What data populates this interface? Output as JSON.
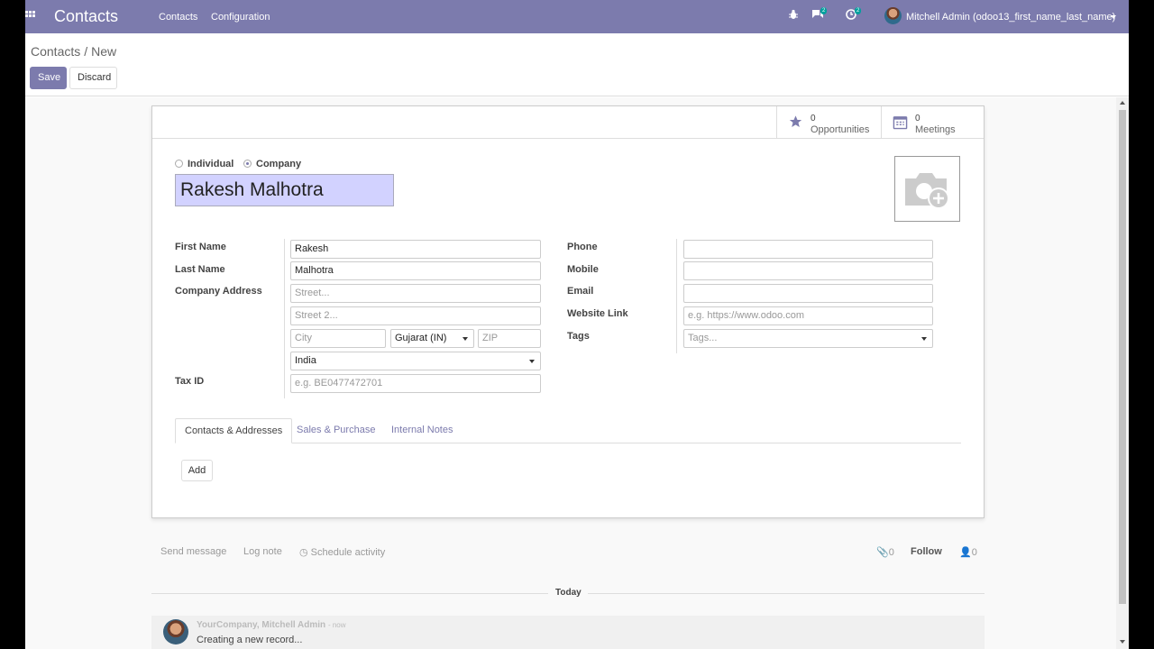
{
  "navbar": {
    "brand": "Contacts",
    "menu": [
      "Contacts",
      "Configuration"
    ],
    "messages_badge": "2",
    "activities_badge": "2",
    "user": "Mitchell Admin (odoo13_first_name_last_name)"
  },
  "breadcrumb": {
    "parent": "Contacts",
    "separator": "/",
    "current": "New"
  },
  "buttons": {
    "save": "Save",
    "discard": "Discard"
  },
  "smart_buttons": [
    {
      "count": "0",
      "label": "Opportunities",
      "icon": "star-icon"
    },
    {
      "count": "0",
      "label": "Meetings",
      "icon": "calendar-icon"
    }
  ],
  "company_type": {
    "individual": "Individual",
    "company": "Company",
    "selected": "Company"
  },
  "name": "Rakesh Malhotra",
  "left_fields": {
    "first_name": {
      "label": "First Name",
      "value": "Rakesh"
    },
    "last_name": {
      "label": "Last Name",
      "value": "Malhotra"
    },
    "address": {
      "label": "Company Address",
      "street_placeholder": "Street...",
      "street2_placeholder": "Street 2...",
      "city_placeholder": "City",
      "state": "Gujarat (IN)",
      "zip_placeholder": "ZIP",
      "country": "India"
    },
    "tax_id": {
      "label": "Tax ID",
      "placeholder": "e.g. BE0477472701"
    }
  },
  "right_fields": {
    "phone": {
      "label": "Phone",
      "value": ""
    },
    "mobile": {
      "label": "Mobile",
      "value": ""
    },
    "email": {
      "label": "Email",
      "value": ""
    },
    "website": {
      "label": "Website Link",
      "placeholder": "e.g. https://www.odoo.com"
    },
    "tags": {
      "label": "Tags",
      "placeholder": "Tags..."
    }
  },
  "tabs": [
    "Contacts & Addresses",
    "Sales & Purchase",
    "Internal Notes"
  ],
  "active_tab": "Contacts & Addresses",
  "add_button": "Add",
  "chatter": {
    "send_message": "Send message",
    "log_note": "Log note",
    "schedule_activity": "Schedule activity",
    "attachments": "0",
    "follow": "Follow",
    "followers": "0",
    "today": "Today",
    "message": {
      "author": "YourCompany, Mitchell Admin",
      "time": "- now",
      "body": "Creating a new record..."
    }
  },
  "colors": {
    "brand": "#7c7bad",
    "name_highlight": "#d2d2ff"
  }
}
